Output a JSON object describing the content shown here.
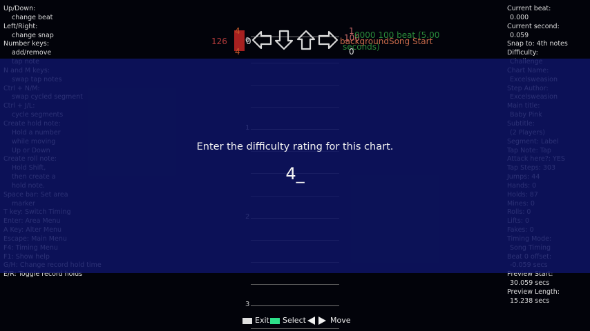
{
  "help_lines": [
    {
      "text": "Up/Down:",
      "indent": false
    },
    {
      "text": "change beat",
      "indent": true
    },
    {
      "text": "Left/Right:",
      "indent": false
    },
    {
      "text": "change snap",
      "indent": true
    },
    {
      "text": "Number keys:",
      "indent": false
    },
    {
      "text": "add/remove",
      "indent": true
    },
    {
      "text": "tap note",
      "indent": true
    },
    {
      "text": "N and M keys:",
      "indent": false
    },
    {
      "text": "swap tap notes",
      "indent": true
    },
    {
      "text": "Ctrl + N/M:",
      "indent": false
    },
    {
      "text": "swap cycled segment",
      "indent": true
    },
    {
      "text": "Ctrl + J/L:",
      "indent": false
    },
    {
      "text": "cycle segments",
      "indent": true
    },
    {
      "text": "Create hold note:",
      "indent": false
    },
    {
      "text": "Hold a number",
      "indent": true
    },
    {
      "text": "while moving",
      "indent": true
    },
    {
      "text": "Up or Down",
      "indent": true
    },
    {
      "text": "Create roll note:",
      "indent": false
    },
    {
      "text": "Hold Shift,",
      "indent": true
    },
    {
      "text": "then create a",
      "indent": true
    },
    {
      "text": "hold note.",
      "indent": true
    },
    {
      "text": "Space bar: Set area",
      "indent": false
    },
    {
      "text": "marker",
      "indent": true
    },
    {
      "text": "T key: Switch Timing",
      "indent": false
    },
    {
      "text": "Enter: Area Menu",
      "indent": false
    },
    {
      "text": "A Key: Alter Menu",
      "indent": false
    },
    {
      "text": "Escape: Main Menu",
      "indent": false
    },
    {
      "text": "F4: Timing Menu",
      "indent": false
    },
    {
      "text": "F1: Show help",
      "indent": false
    },
    {
      "text": "G/H: Change record hold time",
      "indent": false
    },
    {
      "text": "E/R: Toggle record holds",
      "indent": false
    }
  ],
  "info_lines": [
    {
      "text": "Current beat:",
      "indent": false
    },
    {
      "text": "0.000",
      "indent": true
    },
    {
      "text": "Current second:",
      "indent": false
    },
    {
      "text": "0.059",
      "indent": true
    },
    {
      "text": "Snap to: 4th notes",
      "indent": false
    },
    {
      "text": "Difficulty:",
      "indent": false
    },
    {
      "text": "Challenge",
      "indent": true
    },
    {
      "text": "Chart Name:",
      "indent": false
    },
    {
      "text": "Excelsweasion",
      "indent": true
    },
    {
      "text": "Step Author:",
      "indent": false
    },
    {
      "text": "Excelsweasion",
      "indent": true
    },
    {
      "text": "Main title:",
      "indent": false
    },
    {
      "text": "Baby Pink",
      "indent": true
    },
    {
      "text": "Subtitle:",
      "indent": false
    },
    {
      "text": "(2 Players)",
      "indent": true
    },
    {
      "text": "Segment: Label",
      "indent": false
    },
    {
      "text": "Tap Note: Tap",
      "indent": false
    },
    {
      "text": "Attack here?: YES",
      "indent": false
    },
    {
      "text": "Tap Steps: 303",
      "indent": false
    },
    {
      "text": "Jumps: 44",
      "indent": false
    },
    {
      "text": "Hands: 0",
      "indent": false
    },
    {
      "text": "Holds: 87",
      "indent": false
    },
    {
      "text": "Mines: 0",
      "indent": false
    },
    {
      "text": "Rolls: 0",
      "indent": false
    },
    {
      "text": "Lifts: 0",
      "indent": false
    },
    {
      "text": "Fakes: 0",
      "indent": false
    },
    {
      "text": "Timing Mode:",
      "indent": false
    },
    {
      "text": "Song Timing",
      "indent": true
    },
    {
      "text": "Beat 0 offset:",
      "indent": false
    },
    {
      "text": "-0.059 secs",
      "indent": true
    },
    {
      "text": "Preview Start:",
      "indent": false
    },
    {
      "text": "30.059 secs",
      "indent": true
    },
    {
      "text": "Preview Length:",
      "indent": false
    },
    {
      "text": "15.238 secs",
      "indent": true
    }
  ],
  "beat_numbers": [
    "0",
    "1",
    "2",
    "3"
  ],
  "segments": {
    "bpm_value": "126",
    "stop_value": "4",
    "stop_value_bottom": "4",
    "warp_value": "1",
    "speed_value": "0",
    "speed_value_right": "0",
    "beat_value": "100",
    "label_value": "0000 100 beat (5.00",
    "label_value_2": "seconds)",
    "bg_change": "backgroundSong Start"
  },
  "prompt": {
    "message": "Enter the difficulty rating for this chart.",
    "value": "4_"
  },
  "footer": {
    "exit_label": "Exit",
    "select_label": "Select",
    "move_label": "Move"
  },
  "colors": {
    "overlay": "#0e1464",
    "bpm": "#a62020",
    "label": "#2a8a3a",
    "select_key": "#2ee08a",
    "exit_key": "#e0e0e0"
  }
}
